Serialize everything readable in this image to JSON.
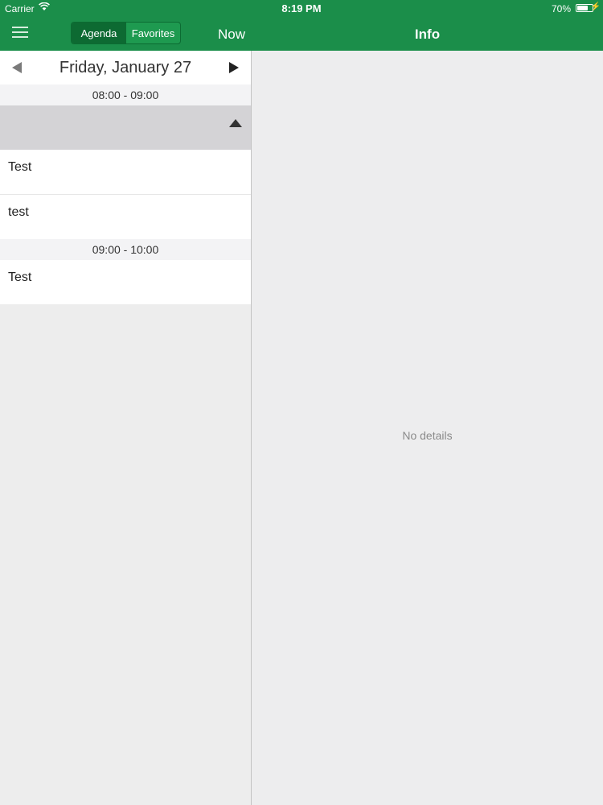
{
  "status_bar": {
    "carrier": "Carrier",
    "time": "8:19 PM",
    "battery_pct": "70%",
    "battery_level": 0.7
  },
  "navbar": {
    "segments": [
      "Agenda",
      "Favorites"
    ],
    "now_label": "Now",
    "info_title": "Info",
    "accent_color": "#1b8e4a"
  },
  "agenda": {
    "date": "Friday, January 27",
    "slot1_time": "08:00 - 09:00",
    "slot1_events": [
      "Test",
      "test"
    ],
    "slot2_time": "09:00 - 10:00",
    "slot2_events": [
      "Test"
    ]
  },
  "details": {
    "empty_text": "No details"
  }
}
